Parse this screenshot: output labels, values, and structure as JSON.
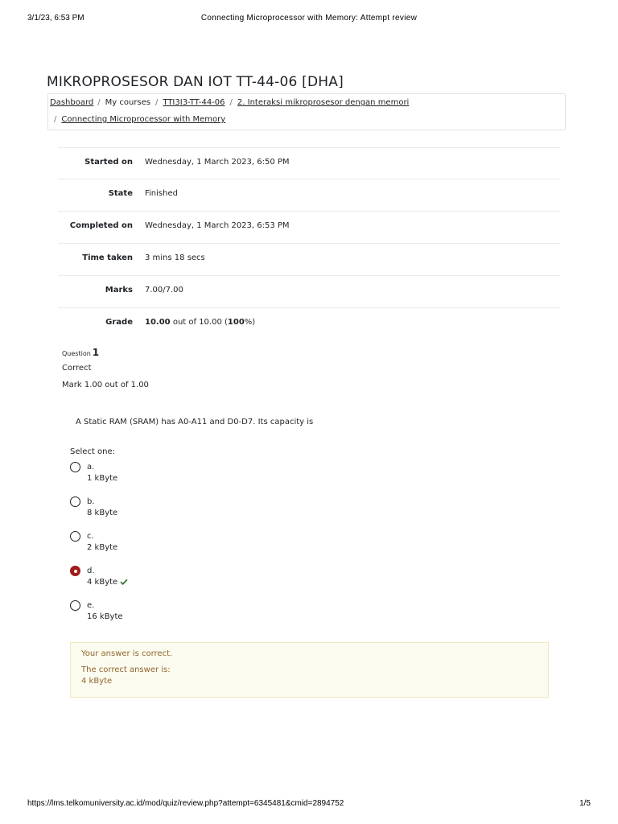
{
  "print": {
    "datetime": "3/1/23, 6:53 PM",
    "title": "Connecting Microprocessor with Memory: Attempt review",
    "url": "https://lms.telkomuniversity.ac.id/mod/quiz/review.php?attempt=6345481&cmid=2894752",
    "page": "1/5"
  },
  "course": {
    "title": "MIKROPROSESOR DAN IOT TT-44-06 [DHA]"
  },
  "breadcrumb": {
    "dashboard": "Dashboard",
    "my_courses": "My courses",
    "course_code": "TTI3I3-TT-44-06",
    "section": "2. Interaksi mikroprosesor dengan memori",
    "quiz": "Connecting Microprocessor with Memory",
    "separator": "/"
  },
  "summary": {
    "started_label": "Started on",
    "started_value": "Wednesday, 1 March 2023, 6:50 PM",
    "state_label": "State",
    "state_value": "Finished",
    "completed_label": "Completed on",
    "completed_value": "Wednesday, 1 March 2023, 6:53 PM",
    "time_label": "Time taken",
    "time_value": "3 mins 18 secs",
    "marks_label": "Marks",
    "marks_value": "7.00/7.00",
    "grade_label": "Grade",
    "grade_score": "10.00",
    "grade_mid": " out of 10.00 (",
    "grade_percent": "100",
    "grade_end": "%)"
  },
  "question": {
    "label": "Question",
    "number": "1",
    "state": "Correct",
    "grade": "Mark 1.00 out of 1.00",
    "text": "A Static RAM (SRAM) has A0-A11 and D0-D7. Its capacity is",
    "prompt": "Select one:",
    "options": [
      {
        "letter": "a.",
        "text": "1 kByte"
      },
      {
        "letter": "b.",
        "text": "8 kByte"
      },
      {
        "letter": "c.",
        "text": "2 kByte"
      },
      {
        "letter": "d.",
        "text": "4 kByte"
      },
      {
        "letter": "e.",
        "text": "16 kByte"
      }
    ],
    "selected_index": 3
  },
  "feedback": {
    "result": "Your answer is correct.",
    "correct_label": "The correct answer is:",
    "correct_answer": "4 kByte"
  },
  "colors": {
    "radio_selected": "#a21a1a",
    "check_icon": "#357a32",
    "feedback_text": "#8e662e",
    "feedback_bg": "#fcfbef"
  }
}
